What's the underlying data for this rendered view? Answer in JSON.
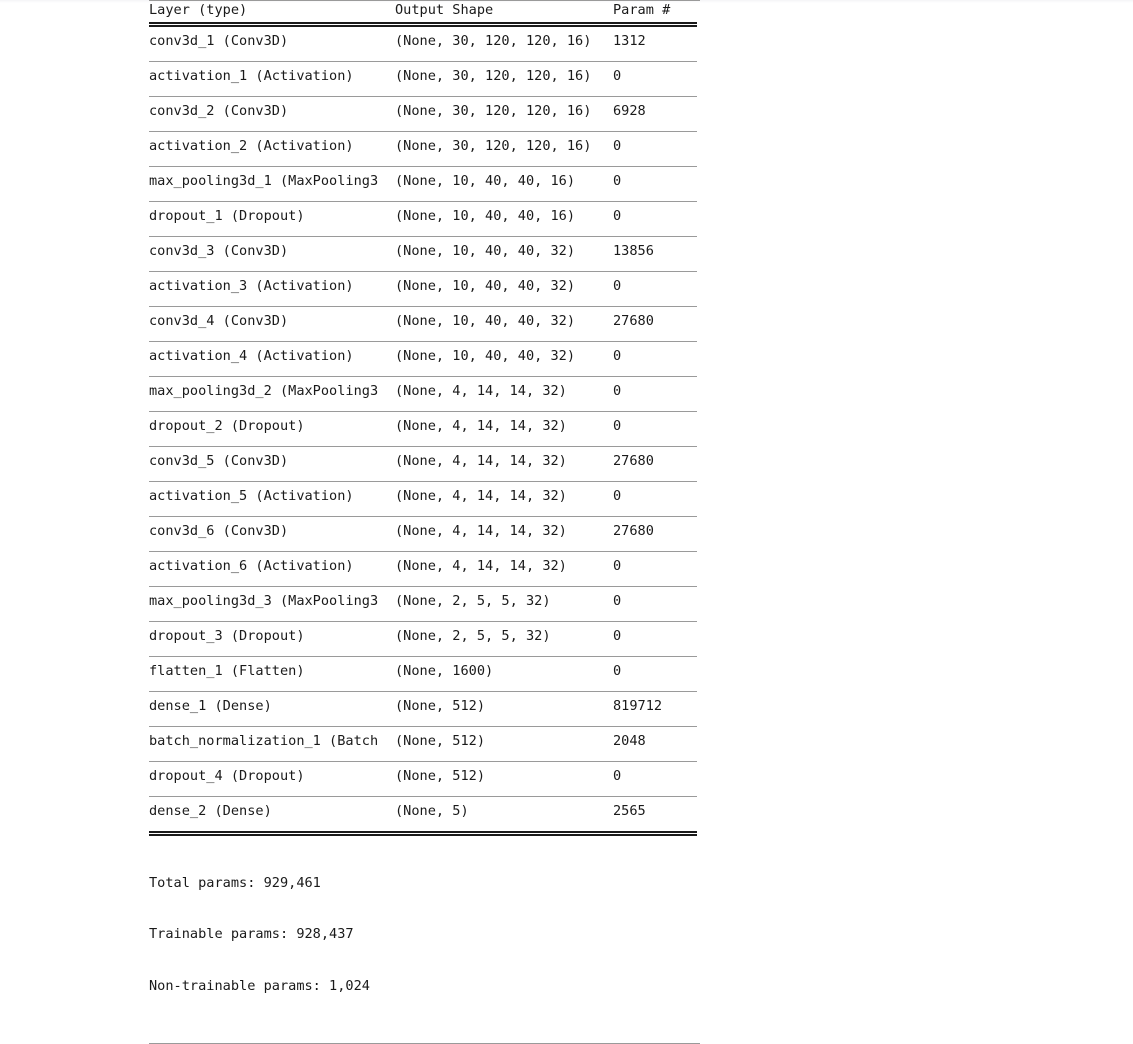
{
  "summary": {
    "columns": {
      "layer": "Layer (type)",
      "output_shape": "Output Shape",
      "param": "Param #"
    },
    "rows": [
      {
        "name": "conv3d_1 (Conv3D)",
        "shape": "(None, 30, 120, 120, 16)",
        "param": "1312"
      },
      {
        "name": "activation_1 (Activation)",
        "shape": "(None, 30, 120, 120, 16)",
        "param": "0"
      },
      {
        "name": "conv3d_2 (Conv3D)",
        "shape": "(None, 30, 120, 120, 16)",
        "param": "6928"
      },
      {
        "name": "activation_2 (Activation)",
        "shape": "(None, 30, 120, 120, 16)",
        "param": "0"
      },
      {
        "name": "max_pooling3d_1 (MaxPooling3",
        "shape": "(None, 10, 40, 40, 16)",
        "param": "0"
      },
      {
        "name": "dropout_1 (Dropout)",
        "shape": "(None, 10, 40, 40, 16)",
        "param": "0"
      },
      {
        "name": "conv3d_3 (Conv3D)",
        "shape": "(None, 10, 40, 40, 32)",
        "param": "13856"
      },
      {
        "name": "activation_3 (Activation)",
        "shape": "(None, 10, 40, 40, 32)",
        "param": "0"
      },
      {
        "name": "conv3d_4 (Conv3D)",
        "shape": "(None, 10, 40, 40, 32)",
        "param": "27680"
      },
      {
        "name": "activation_4 (Activation)",
        "shape": "(None, 10, 40, 40, 32)",
        "param": "0"
      },
      {
        "name": "max_pooling3d_2 (MaxPooling3",
        "shape": "(None, 4, 14, 14, 32)",
        "param": "0"
      },
      {
        "name": "dropout_2 (Dropout)",
        "shape": "(None, 4, 14, 14, 32)",
        "param": "0"
      },
      {
        "name": "conv3d_5 (Conv3D)",
        "shape": "(None, 4, 14, 14, 32)",
        "param": "27680"
      },
      {
        "name": "activation_5 (Activation)",
        "shape": "(None, 4, 14, 14, 32)",
        "param": "0"
      },
      {
        "name": "conv3d_6 (Conv3D)",
        "shape": "(None, 4, 14, 14, 32)",
        "param": "27680"
      },
      {
        "name": "activation_6 (Activation)",
        "shape": "(None, 4, 14, 14, 32)",
        "param": "0"
      },
      {
        "name": "max_pooling3d_3 (MaxPooling3",
        "shape": "(None, 2, 5, 5, 32)",
        "param": "0"
      },
      {
        "name": "dropout_3 (Dropout)",
        "shape": "(None, 2, 5, 5, 32)",
        "param": "0"
      },
      {
        "name": "flatten_1 (Flatten)",
        "shape": "(None, 1600)",
        "param": "0"
      },
      {
        "name": "dense_1 (Dense)",
        "shape": "(None, 512)",
        "param": "819712"
      },
      {
        "name": "batch_normalization_1 (Batch",
        "shape": "(None, 512)",
        "param": "2048"
      },
      {
        "name": "dropout_4 (Dropout)",
        "shape": "(None, 512)",
        "param": "0"
      },
      {
        "name": "dense_2 (Dense)",
        "shape": "(None, 5)",
        "param": "2565"
      }
    ],
    "footer": {
      "total_params": "Total params: 929,461",
      "trainable_params": "Trainable params: 928,437",
      "non_trainable_params": "Non-trainable params: 1,024"
    }
  }
}
